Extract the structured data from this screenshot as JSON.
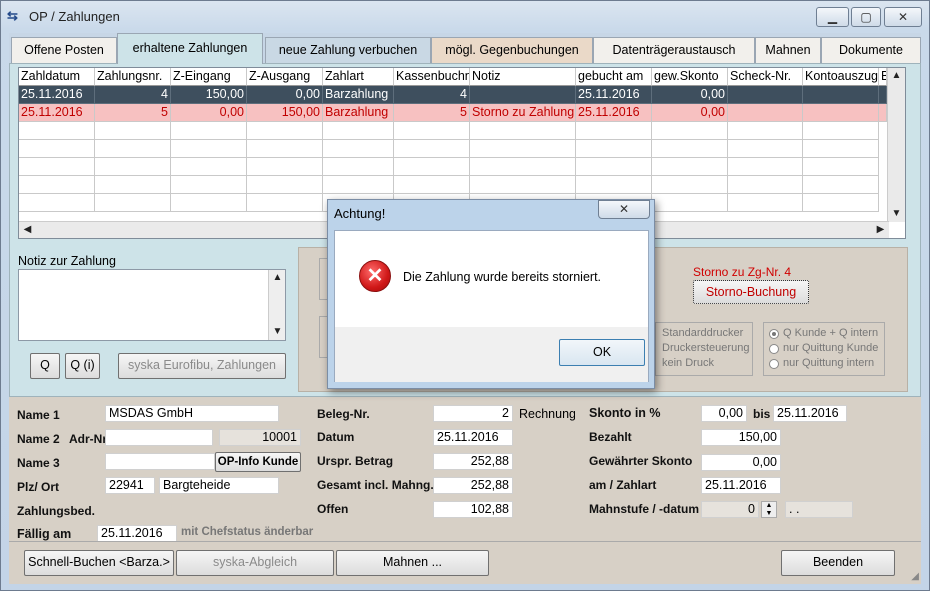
{
  "window": {
    "title": "OP / Zahlungen",
    "min": "▁",
    "max": "▢",
    "close": "✕"
  },
  "tabs": [
    "Offene Posten",
    "erhaltene Zahlungen",
    "neue Zahlung verbuchen",
    "mögl. Gegenbuchungen",
    "Datenträgeraustausch",
    "Mahnen",
    "Dokumente"
  ],
  "table": {
    "headers": [
      "Zahldatum",
      "Zahlungsnr.",
      "Z-Eingang",
      "Z-Ausgang",
      "Zahlart",
      "Kassenbuchnr.",
      "Notiz",
      "gebucht am",
      "gew.Skonto",
      "Scheck-Nr.",
      "Kontoauszug-Nr.",
      "B"
    ],
    "rows": [
      [
        "25.11.2016",
        "4",
        "150,00",
        "0,00",
        "Barzahlung",
        "4",
        "",
        "25.11.2016",
        "0,00",
        "",
        ""
      ],
      [
        "25.11.2016",
        "5",
        "0,00",
        "150,00",
        "Barzahlung",
        "5",
        "Storno zu Zahlung",
        "25.11.2016",
        "0,00",
        "",
        ""
      ]
    ]
  },
  "notiz": {
    "label": "Notiz zur Zahlung",
    "value": ""
  },
  "left_buttons": {
    "q": "Q",
    "qi": "Q (i)",
    "eurofibu": "syska Eurofibu, Zahlungen"
  },
  "storno": {
    "info": "Storno zu Zg-Nr. 4",
    "button": "Storno-Buchung"
  },
  "print_options": [
    "Standarddrucker",
    "Druckersteuerung",
    "kein Druck"
  ],
  "receipt_options": [
    "Q Kunde + Q intern",
    "nur Quittung Kunde",
    "nur Quittung intern"
  ],
  "dialog": {
    "title": "Achtung!",
    "message": "Die Zahlung wurde bereits storniert.",
    "ok": "OK",
    "close": "✕"
  },
  "customer": {
    "name1_label": "Name 1",
    "name1": "MSDAS GmbH",
    "name2_label": "Name 2",
    "adr_label": "Adr-Nr.",
    "name2": "",
    "adr_nr": "10001",
    "name3_label": "Name 3",
    "name3": "",
    "op_info": "OP-Info Kunde",
    "plz_label": "Plz/ Ort",
    "plz": "22941",
    "ort": "Bargteheide",
    "zahlungsbed_label": "Zahlungsbed.",
    "faellig_label": "Fällig am",
    "faellig": "25.11.2016",
    "faellig_note": "mit Chefstatus änderbar"
  },
  "beleg": {
    "beleg_label": "Beleg-Nr.",
    "beleg": "2",
    "rechnung": "Rechnung",
    "datum_label": "Datum",
    "datum": "25.11.2016",
    "urspr_label": "Urspr. Betrag",
    "urspr": "252,88",
    "gesamt_label": "Gesamt incl. Mahng.",
    "gesamt": "252,88",
    "offen_label": "Offen",
    "offen": "102,88"
  },
  "payment": {
    "skonto_label": "Skonto in %",
    "skonto": "0,00",
    "bis_label": "bis",
    "bis": "25.11.2016",
    "bezahlt_label": "Bezahlt",
    "bezahlt": "150,00",
    "gew_label": "Gewährter Skonto",
    "gew": "0,00",
    "am_label": "am / Zahlart",
    "am": "25.11.2016",
    "mahn_label": "Mahnstufe / -datum",
    "mahn": "0",
    "mahn_datum": ". ."
  },
  "footer": {
    "schnell": "Schnell-Buchen <Barza.>",
    "abgleich": "syska-Abgleich",
    "mahnen": "Mahnen ...",
    "beenden": "Beenden"
  }
}
